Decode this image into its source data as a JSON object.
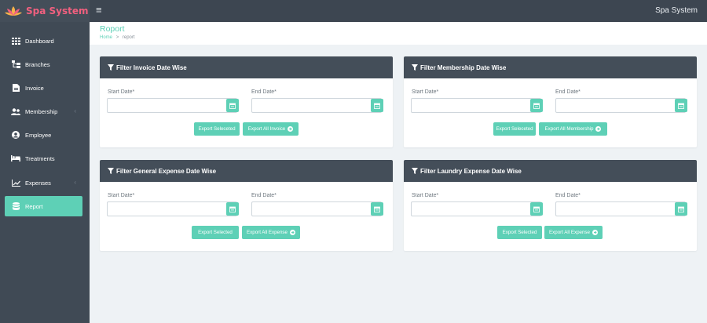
{
  "app": {
    "logo_text": "Spa System",
    "top_right_text": "Spa System"
  },
  "sidebar": {
    "items": [
      {
        "label": "Dashboard",
        "icon": "grid-icon"
      },
      {
        "label": "Branches",
        "icon": "branches-icon"
      },
      {
        "label": "Invoice",
        "icon": "file-icon"
      },
      {
        "label": "Membership",
        "icon": "users-icon",
        "has_chevron": true
      },
      {
        "label": "Employee",
        "icon": "user-circle-icon"
      },
      {
        "label": "Treatments",
        "icon": "bed-icon"
      },
      {
        "label": "Expenses",
        "icon": "chart-line-icon",
        "has_chevron": true
      },
      {
        "label": "Report",
        "icon": "database-icon",
        "active": true
      }
    ],
    "chevron_glyph": "‹"
  },
  "header": {
    "title": "Roport",
    "breadcrumb_home": "Home",
    "breadcrumb_sep": ">",
    "breadcrumb_current": "report"
  },
  "cards": [
    {
      "title": "Filter Invoice Date Wise",
      "start_label": "Start Date*",
      "end_label": "End Date*",
      "export_selected": "Export Seleceted",
      "export_all": "Export All Invoice"
    },
    {
      "title": "Filter Membership Date Wise",
      "start_label": "Start Date*",
      "end_label": "End Date*",
      "export_selected": "Export Seleceted",
      "export_all": "Export All Membership"
    },
    {
      "title": "Filter General Expense Date Wise",
      "start_label": "Start Date*",
      "end_label": "End Date*",
      "export_selected": "Export Selected",
      "export_all": "Export All Expense"
    },
    {
      "title": "Filter Laundry Expense Date Wise",
      "start_label": "Start Date*",
      "end_label": "End Date*",
      "export_selected": "Export Selected",
      "export_all": "Export All Expense"
    }
  ],
  "colors": {
    "accent": "#5ed0b6",
    "sidebar": "#404a55",
    "card_header": "#444e59",
    "logo": "#f2607f"
  }
}
